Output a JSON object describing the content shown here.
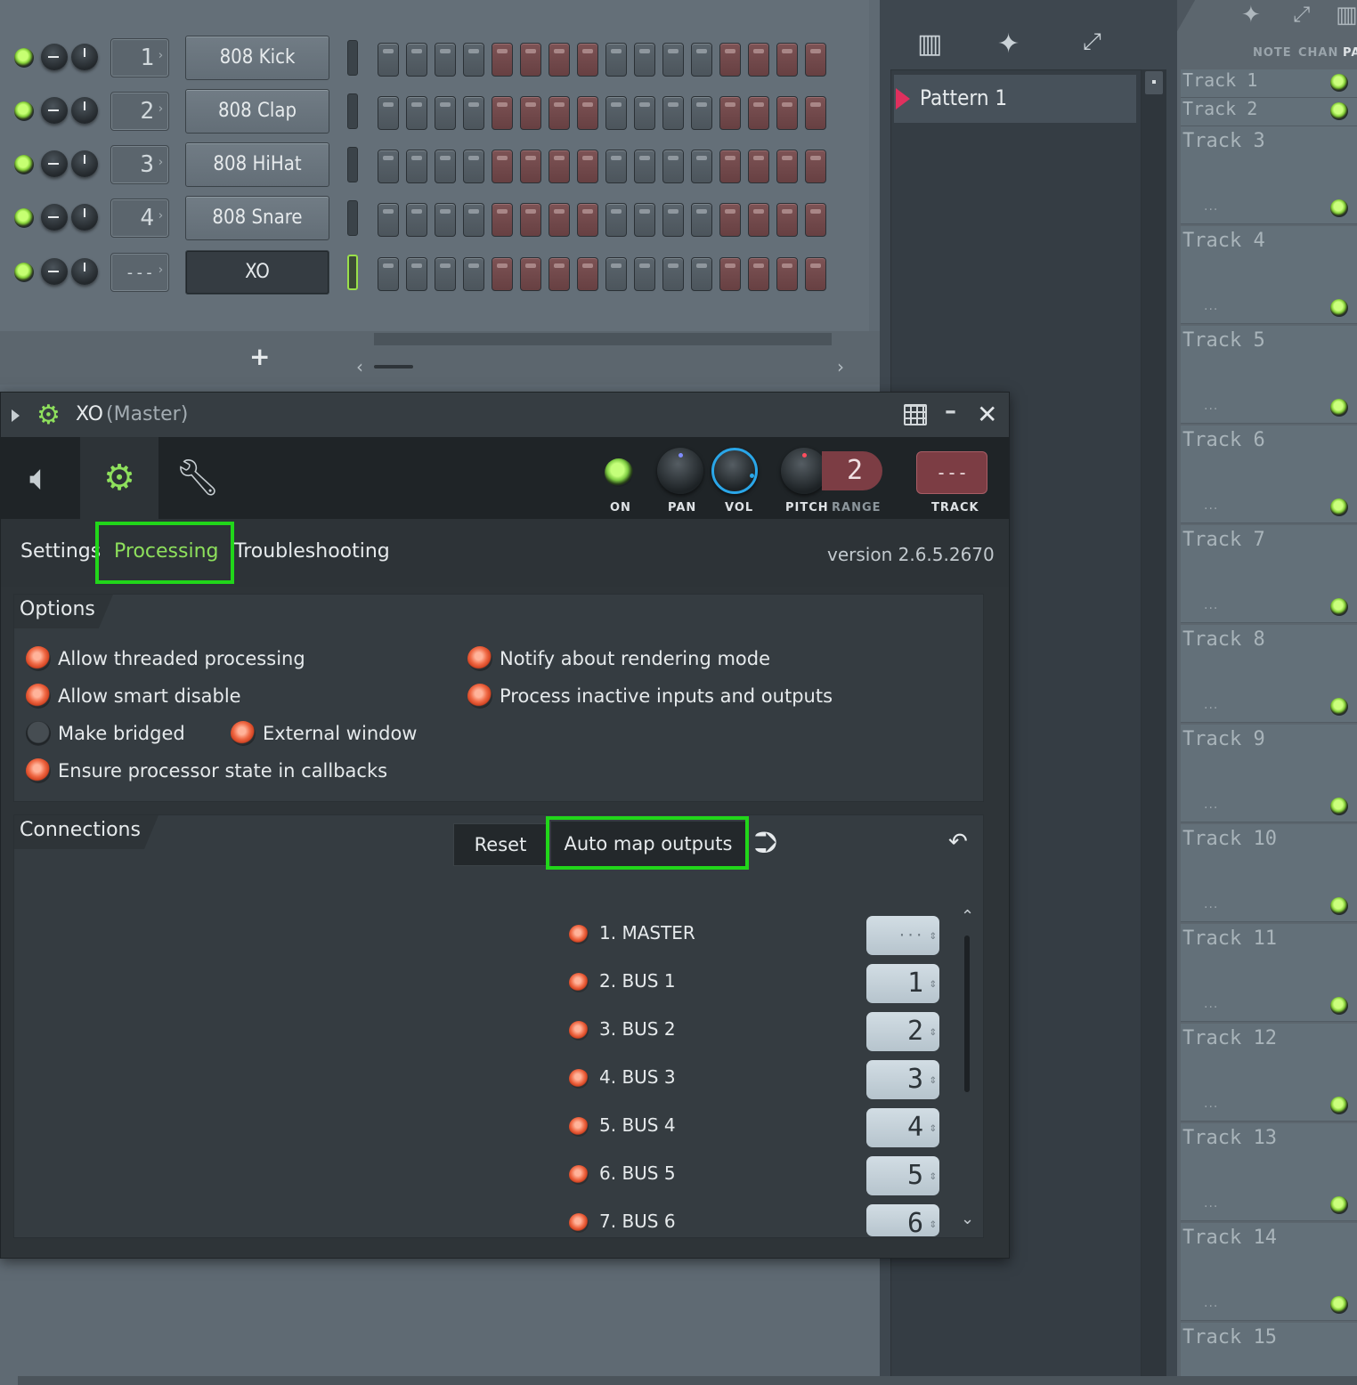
{
  "channels": [
    {
      "num": "1",
      "name": "808 Kick",
      "selected": false
    },
    {
      "num": "2",
      "name": "808 Clap",
      "selected": false
    },
    {
      "num": "3",
      "name": "808 HiHat",
      "selected": false
    },
    {
      "num": "4",
      "name": "808 Snare",
      "selected": false
    },
    {
      "num": "---",
      "name": "XO",
      "selected": true
    }
  ],
  "rack": {
    "add_label": "+"
  },
  "picker": {
    "pattern_name": "Pattern 1"
  },
  "playlist": {
    "header_note": "NOTE",
    "header_chan": "CHAN",
    "header_pat": "PA",
    "tracks": [
      "Track 1",
      "Track 2",
      "Track 3",
      "Track 4",
      "Track 5",
      "Track 6",
      "Track 7",
      "Track 8",
      "Track 9",
      "Track 10",
      "Track 11",
      "Track 12",
      "Track 13",
      "Track 14",
      "Track 15"
    ]
  },
  "window": {
    "title": "XO",
    "subtitle": "(Master)",
    "knobs": {
      "on": "ON",
      "pan": "PAN",
      "vol": "VOL",
      "pitch": "PITCH",
      "range": "RANGE",
      "track": "TRACK",
      "range_value": "2",
      "track_value": "---"
    },
    "tabs": {
      "settings": "Settings",
      "processing": "Processing",
      "troubleshooting": "Troubleshooting"
    },
    "version": "version 2.6.5.2670",
    "options": {
      "title": "Options",
      "allow_threaded": "Allow threaded processing",
      "allow_smart_disable": "Allow smart disable",
      "make_bridged": "Make bridged",
      "external_window": "External window",
      "ensure_state": "Ensure processor state in callbacks",
      "notify_rendering": "Notify about rendering mode",
      "process_inactive": "Process inactive inputs and outputs"
    },
    "connections": {
      "title": "Connections",
      "reset": "Reset",
      "auto_map": "Auto map outputs",
      "outputs": [
        {
          "label": "1. MASTER",
          "value": "···"
        },
        {
          "label": "2. BUS 1",
          "value": "1"
        },
        {
          "label": "3. BUS 2",
          "value": "2"
        },
        {
          "label": "4. BUS 3",
          "value": "3"
        },
        {
          "label": "5. BUS 4",
          "value": "4"
        },
        {
          "label": "6. BUS 5",
          "value": "5"
        },
        {
          "label": "7. BUS 6",
          "value": "6"
        }
      ]
    }
  },
  "colors": {
    "accent_green": "#8ee05c",
    "highlight_green": "#21d61a",
    "vol_ring": "#2aa6e8",
    "track_box": "#7c3d44"
  }
}
